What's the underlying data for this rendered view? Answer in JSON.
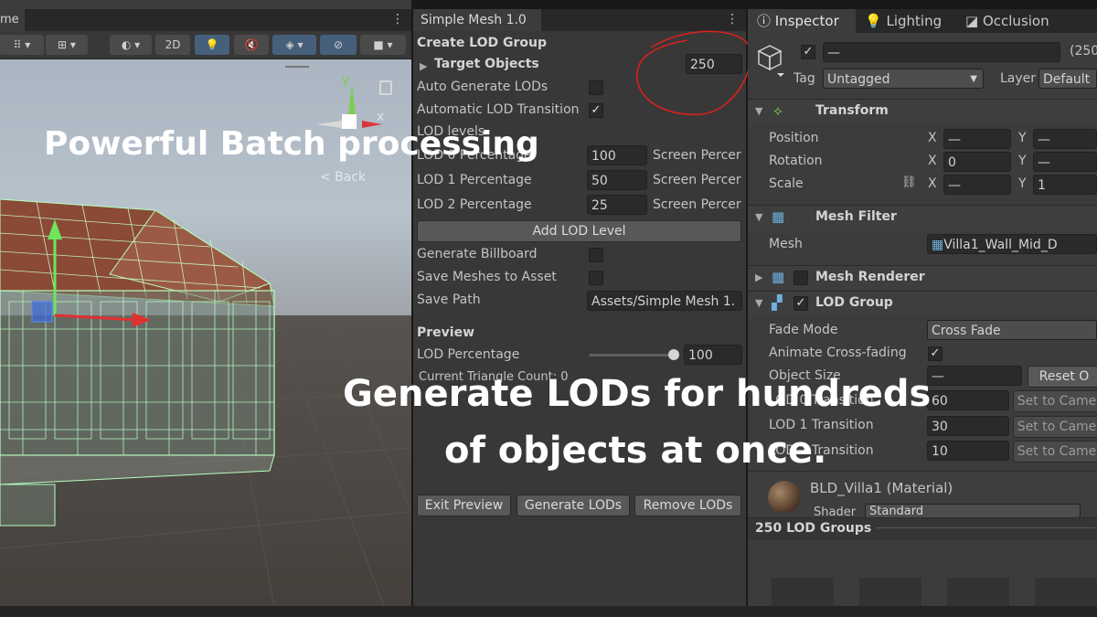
{
  "scene": {
    "tab_label": "me",
    "toolbar": {
      "mode_2d": "2D"
    },
    "gizmo": {
      "y_axis": "y",
      "x_axis": "x"
    },
    "back_label": "< Back"
  },
  "captions": {
    "top": "Powerful Batch processing",
    "middle_line1": "Generate LODs for hundreds",
    "middle_line2": "of objects at once."
  },
  "tool_panel": {
    "tab_title": "Simple Mesh 1.0",
    "section_title": "Create LOD Group",
    "target_objects_label": "Target Objects",
    "target_objects_count": "250",
    "auto_generate_label": "Auto Generate LODs",
    "auto_generate_checked": false,
    "auto_transition_label": "Automatic LOD Transition",
    "auto_transition_checked": true,
    "lod_levels_label": "LOD levels",
    "lod_rows": [
      {
        "label": "LOD 0 Percentage",
        "value": "100",
        "mode": "Screen Percer"
      },
      {
        "label": "LOD 1 Percentage",
        "value": "50",
        "mode": "Screen Percer"
      },
      {
        "label": "LOD 2 Percentage",
        "value": "25",
        "mode": "Screen Percer"
      }
    ],
    "add_lod_button": "Add LOD Level",
    "generate_billboard_label": "Generate Billboard",
    "save_meshes_label": "Save Meshes to Asset",
    "save_path_label": "Save Path",
    "save_path_value": "Assets/Simple Mesh 1.",
    "preview_title": "Preview",
    "lod_percentage_label": "LOD Percentage",
    "lod_percentage_value": "100",
    "triangle_count_label": "Current Triangle Count: 0",
    "exit_preview_button": "Exit Preview",
    "generate_lods_button": "Generate LODs",
    "remove_lods_button": "Remove LODs"
  },
  "inspector": {
    "tabs": [
      "Inspector",
      "Lighting",
      "Occlusion"
    ],
    "name_value": "—",
    "count_suffix": "(250",
    "tag_label": "Tag",
    "tag_value": "Untagged",
    "layer_label": "Layer",
    "layer_value": "Default",
    "transform": {
      "title": "Transform",
      "position_label": "Position",
      "rotation_label": "Rotation",
      "scale_label": "Scale",
      "x_label": "X",
      "y_label": "Y",
      "position_x": "—",
      "position_y": "—",
      "rotation_x": "0",
      "rotation_y": "—",
      "scale_x": "—",
      "scale_y": "1"
    },
    "mesh_filter": {
      "title": "Mesh Filter",
      "mesh_label": "Mesh",
      "mesh_value": "Villa1_Wall_Mid_D"
    },
    "mesh_renderer": {
      "title": "Mesh Renderer"
    },
    "lod_group": {
      "title": "LOD Group",
      "fade_mode_label": "Fade Mode",
      "fade_mode_value": "Cross Fade",
      "animate_label": "Animate Cross-fading",
      "object_size_label": "Object Size",
      "object_size_value": "—",
      "reset_button": "Reset O",
      "transitions": [
        {
          "label": "LOD 0 Transition",
          "value": "60",
          "button": "Set to Came"
        },
        {
          "label": "LOD 1 Transition",
          "value": "30",
          "button": "Set to Came"
        },
        {
          "label": "LOD 2 Transition",
          "value": "10",
          "button": "Set to Came"
        }
      ]
    },
    "material": {
      "name": "BLD_Villa1 (Material)",
      "shader_label": "Shader",
      "shader_value": "Standard"
    },
    "footer": "250 LOD Groups"
  },
  "colors": {
    "panel_bg": "#383838",
    "field_bg": "#2a2a2a",
    "annotation_red": "#d9211c",
    "wireframe": "#9dffa8"
  }
}
